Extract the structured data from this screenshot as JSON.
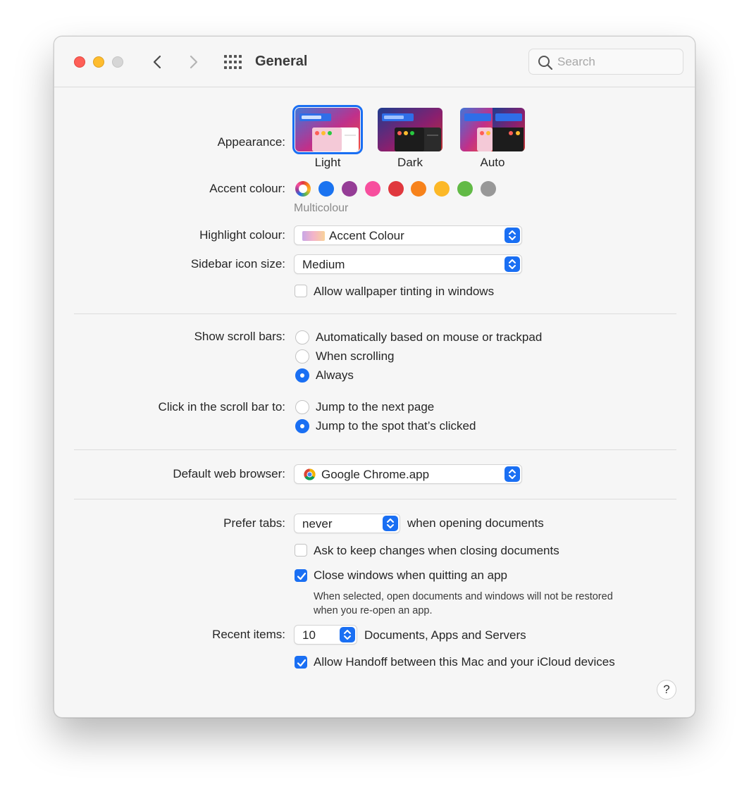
{
  "window": {
    "title": "General",
    "search_placeholder": "Search"
  },
  "appearance": {
    "label": "Appearance:",
    "options": [
      {
        "name": "Light",
        "selected": true
      },
      {
        "name": "Dark",
        "selected": false
      },
      {
        "name": "Auto",
        "selected": false
      }
    ]
  },
  "accent": {
    "label": "Accent colour:",
    "selected_caption": "Multicolour",
    "colors": [
      "multicolour",
      "#1a73f0",
      "#953d96",
      "#f74f9e",
      "#e0383e",
      "#f7821b",
      "#fcb827",
      "#62ba46",
      "#989898"
    ]
  },
  "highlight": {
    "label": "Highlight colour:",
    "value": "Accent Colour"
  },
  "sidebar_icon_size": {
    "label": "Sidebar icon size:",
    "value": "Medium"
  },
  "wallpaper_tinting": {
    "label": "Allow wallpaper tinting in windows",
    "checked": false
  },
  "scroll_bars": {
    "label": "Show scroll bars:",
    "options": [
      {
        "label": "Automatically based on mouse or trackpad",
        "selected": false
      },
      {
        "label": "When scrolling",
        "selected": false
      },
      {
        "label": "Always",
        "selected": true
      }
    ]
  },
  "click_scroll": {
    "label": "Click in the scroll bar to:",
    "options": [
      {
        "label": "Jump to the next page",
        "selected": false
      },
      {
        "label": "Jump to the spot that’s clicked",
        "selected": true
      }
    ]
  },
  "browser": {
    "label": "Default web browser:",
    "value": "Google Chrome.app",
    "icon": "chrome-icon"
  },
  "prefer_tabs": {
    "label": "Prefer tabs:",
    "value": "never",
    "suffix": "when opening documents"
  },
  "ask_keep_changes": {
    "label": "Ask to keep changes when closing documents",
    "checked": false
  },
  "close_windows": {
    "label": "Close windows when quitting an app",
    "checked": true,
    "note_line1": "When selected, open documents and windows will not be restored",
    "note_line2": "when you re-open an app."
  },
  "recent_items": {
    "label": "Recent items:",
    "value": "10",
    "suffix": "Documents, Apps and Servers"
  },
  "handoff": {
    "label": "Allow Handoff between this Mac and your iCloud devices",
    "checked": true
  },
  "help": {
    "label": "?"
  },
  "colors": {
    "accent": "#1a6ff3",
    "window_bg": "#f6f6f6"
  }
}
